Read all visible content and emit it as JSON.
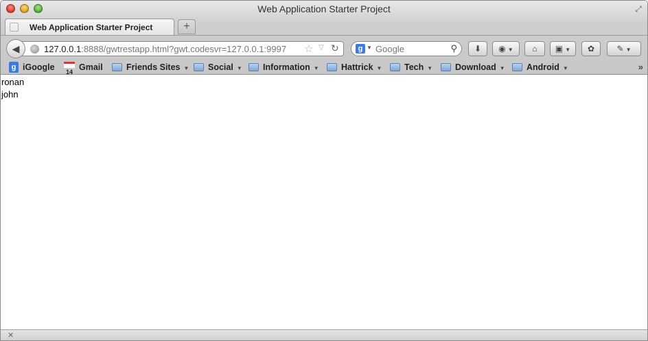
{
  "window": {
    "title": "Web Application Starter Project"
  },
  "tabs": [
    {
      "label": "Web Application Starter Project"
    }
  ],
  "newtab": {
    "label": "+"
  },
  "navbar": {
    "url_host": "127.0.0.1",
    "url_rest": ":8888/gwtrestapp.html?gwt.codesvr=127.0.0.1:9997",
    "search_placeholder": "Google"
  },
  "bookmarks": [
    {
      "label": "iGoogle",
      "icon": "google-icon"
    },
    {
      "label": "Gmail",
      "icon": "gmail-icon",
      "badge": "14"
    },
    {
      "label": "Friends Sites",
      "icon": "folder-icon"
    },
    {
      "label": "Social",
      "icon": "folder-icon"
    },
    {
      "label": "Information",
      "icon": "folder-icon"
    },
    {
      "label": "Hattrick",
      "icon": "folder-icon"
    },
    {
      "label": "Tech",
      "icon": "folder-icon"
    },
    {
      "label": "Download",
      "icon": "folder-icon"
    },
    {
      "label": "Android",
      "icon": "folder-icon"
    }
  ],
  "content": {
    "names": [
      "ronan",
      "john"
    ]
  }
}
